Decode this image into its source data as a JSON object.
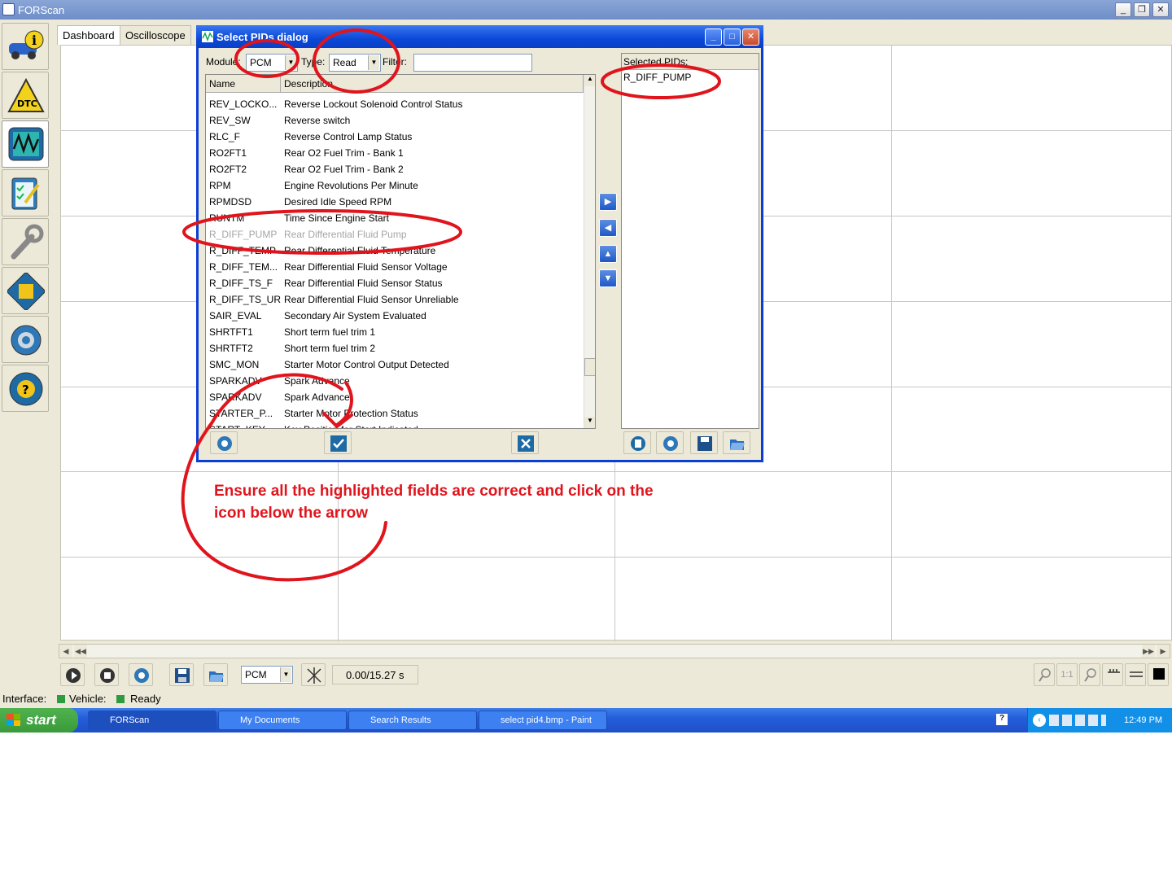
{
  "window": {
    "title": "FORScan"
  },
  "tabs": [
    {
      "label": "Dashboard"
    },
    {
      "label": "Oscilloscope"
    }
  ],
  "sidebar": {
    "items": [
      "info-icon",
      "dtc-icon",
      "oscilloscope-icon",
      "checklist-icon",
      "wrench-icon",
      "module-icon",
      "gear-icon",
      "help-icon"
    ],
    "dtc_text": "DTC"
  },
  "dialog": {
    "title": "Select PIDs dialog",
    "module_label": "Module:",
    "module_value": "PCM",
    "type_label": "Type:",
    "type_value": "Read",
    "filter_label": "Filter:",
    "filter_value": "",
    "col_name": "Name",
    "col_desc": "Description",
    "rows": [
      {
        "name": "REV_LOCKO...",
        "desc": "Reverse Lockout Solenoid Control Status"
      },
      {
        "name": "REV_SW",
        "desc": "Reverse switch"
      },
      {
        "name": "RLC_F",
        "desc": "Reverse Control Lamp Status"
      },
      {
        "name": "RO2FT1",
        "desc": "Rear O2 Fuel Trim - Bank 1"
      },
      {
        "name": "RO2FT2",
        "desc": "Rear O2 Fuel Trim - Bank 2"
      },
      {
        "name": "RPM",
        "desc": "Engine Revolutions Per Minute"
      },
      {
        "name": "RPMDSD",
        "desc": "Desired Idle Speed RPM"
      },
      {
        "name": "RUNTM",
        "desc": "Time Since Engine Start"
      },
      {
        "name": "R_DIFF_PUMP",
        "desc": "Rear Differential Fluid Pump"
      },
      {
        "name": "R_DIFF_TEMP",
        "desc": "Rear Differential Fluid Temperature"
      },
      {
        "name": "R_DIFF_TEM...",
        "desc": "Rear Differential Fluid Sensor Voltage"
      },
      {
        "name": "R_DIFF_TS_F",
        "desc": "Rear Differential Fluid Sensor Status"
      },
      {
        "name": "R_DIFF_TS_UR",
        "desc": "Rear Differential Fluid Sensor Unreliable"
      },
      {
        "name": "SAIR_EVAL",
        "desc": "Secondary Air System Evaluated"
      },
      {
        "name": "SHRTFT1",
        "desc": "Short term fuel trim 1"
      },
      {
        "name": "SHRTFT2",
        "desc": "Short term fuel trim 2"
      },
      {
        "name": "SMC_MON",
        "desc": "Starter Motor Control Output Detected"
      },
      {
        "name": "SPARKADV",
        "desc": "Spark Advance"
      },
      {
        "name": "SPARKADV",
        "desc": "Spark Advance"
      },
      {
        "name": "STARTER_P...",
        "desc": "Starter Motor Protection Status"
      },
      {
        "name": "START_KEY",
        "desc": "Key Position for Start Indicated"
      }
    ],
    "selected_label": "Selected PIDs:",
    "selected_items": [
      "R_DIFF_PUMP"
    ]
  },
  "toolbar": {
    "module_value": "PCM",
    "time": "0.00/15.27 s",
    "zoom_label": "1:1"
  },
  "status": {
    "interface_label": "Interface:",
    "vehicle_label": "Vehicle:",
    "ready": "Ready"
  },
  "taskbar": {
    "start": "start",
    "tasks": [
      {
        "label": "FORScan"
      },
      {
        "label": "My Documents"
      },
      {
        "label": "Search Results"
      },
      {
        "label": "select pid4.bmp - Paint"
      }
    ],
    "clock": "12:49 PM"
  },
  "annotation": {
    "line1": "Ensure all the highlighted fields are correct and click on the",
    "line2": "icon below the arrow",
    "color": "#e0141c"
  }
}
